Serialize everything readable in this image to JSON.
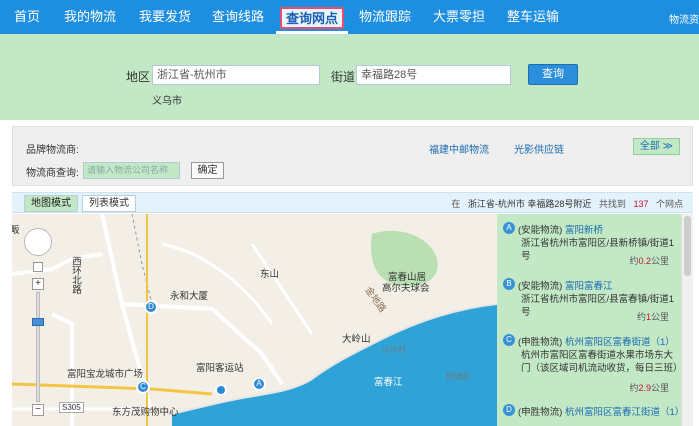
{
  "nav": {
    "items": [
      "首页",
      "我的物流",
      "我要发货",
      "查询线路",
      "查询网点",
      "物流跟踪",
      "大票零担",
      "整车运输"
    ],
    "active_index": 4,
    "right_text": "物流资"
  },
  "search": {
    "region_label": "地区",
    "region_value": "浙江省-杭州市",
    "region_hint": "义乌市",
    "street_label": "街道",
    "street_value": "幸福路28号",
    "query_button": "查询"
  },
  "filters": {
    "brand_label": "品牌物流商:",
    "query_label": "物流商查询:",
    "query_placeholder": "请输入物流公司名称",
    "confirm_button": "确定",
    "brand_links": [
      "福建中邮物流",
      "光影供应链"
    ],
    "all_button": "全部 ≫"
  },
  "modes": {
    "map_mode": "地图模式",
    "list_mode": "列表模式",
    "summary_prefix": "在",
    "summary_location": "浙江省-杭州市 幸福路28号附近",
    "summary_found": "共找到",
    "summary_count": "137",
    "summary_suffix": "个网点"
  },
  "map": {
    "labels": {
      "dongshan": "东山",
      "yonghe": "永和大厦",
      "fuchun_mountain": "富春山居",
      "golf": "高尔夫球会",
      "daling": "大岭山",
      "fuyang_bus": "富阳客运站",
      "baolong": "富阳宝龙城市广场",
      "dongfangmao": "东方茂购物中心",
      "fuchunjiang": "富春江",
      "xihuan": "西环北路",
      "jin_road": "金地路",
      "fuchun_dadao": "富春大道",
      "xiaoshajun": "小沙村",
      "hezhou": "何埭村",
      "s305": "S305",
      "fuyang_xinhua": "富阳新华",
      "qi": "畈",
      "jin": "金庭"
    },
    "pin_letters": [
      "A",
      "B",
      "C",
      "D"
    ]
  },
  "results": [
    {
      "letter": "A",
      "company": "(安能物流)",
      "name": "富阳新桥",
      "address": "浙江省杭州市富阳区/县新桥镇/街道1号",
      "dist_prefix": "约",
      "distance": "0.2",
      "unit": "公里"
    },
    {
      "letter": "B",
      "company": "(安能物流)",
      "name": "富阳富春江",
      "address": "浙江省杭州市富阳区/县富春镇/街道1号",
      "dist_prefix": "约",
      "distance": "1",
      "unit": "公里"
    },
    {
      "letter": "C",
      "company": "(申胜物流)",
      "name": "杭州富阳区富春街道（1）",
      "address": "杭州市富阳区富春街道水果市场东大门（该区域司机流动收货，每日三班）",
      "dist_prefix": "约",
      "distance": "2.9",
      "unit": "公里"
    },
    {
      "letter": "D",
      "company": "(申胜物流)",
      "name": "杭州富阳区富春江街道（1）",
      "address": "",
      "dist_prefix": "",
      "distance": "",
      "unit": ""
    }
  ],
  "colors": {
    "nav_bg": "#1e8fe0",
    "panel_green": "#c2e8c6",
    "accent_red": "#c8102e",
    "link_blue": "#1a6bb0",
    "river": "#2fa3d8"
  }
}
